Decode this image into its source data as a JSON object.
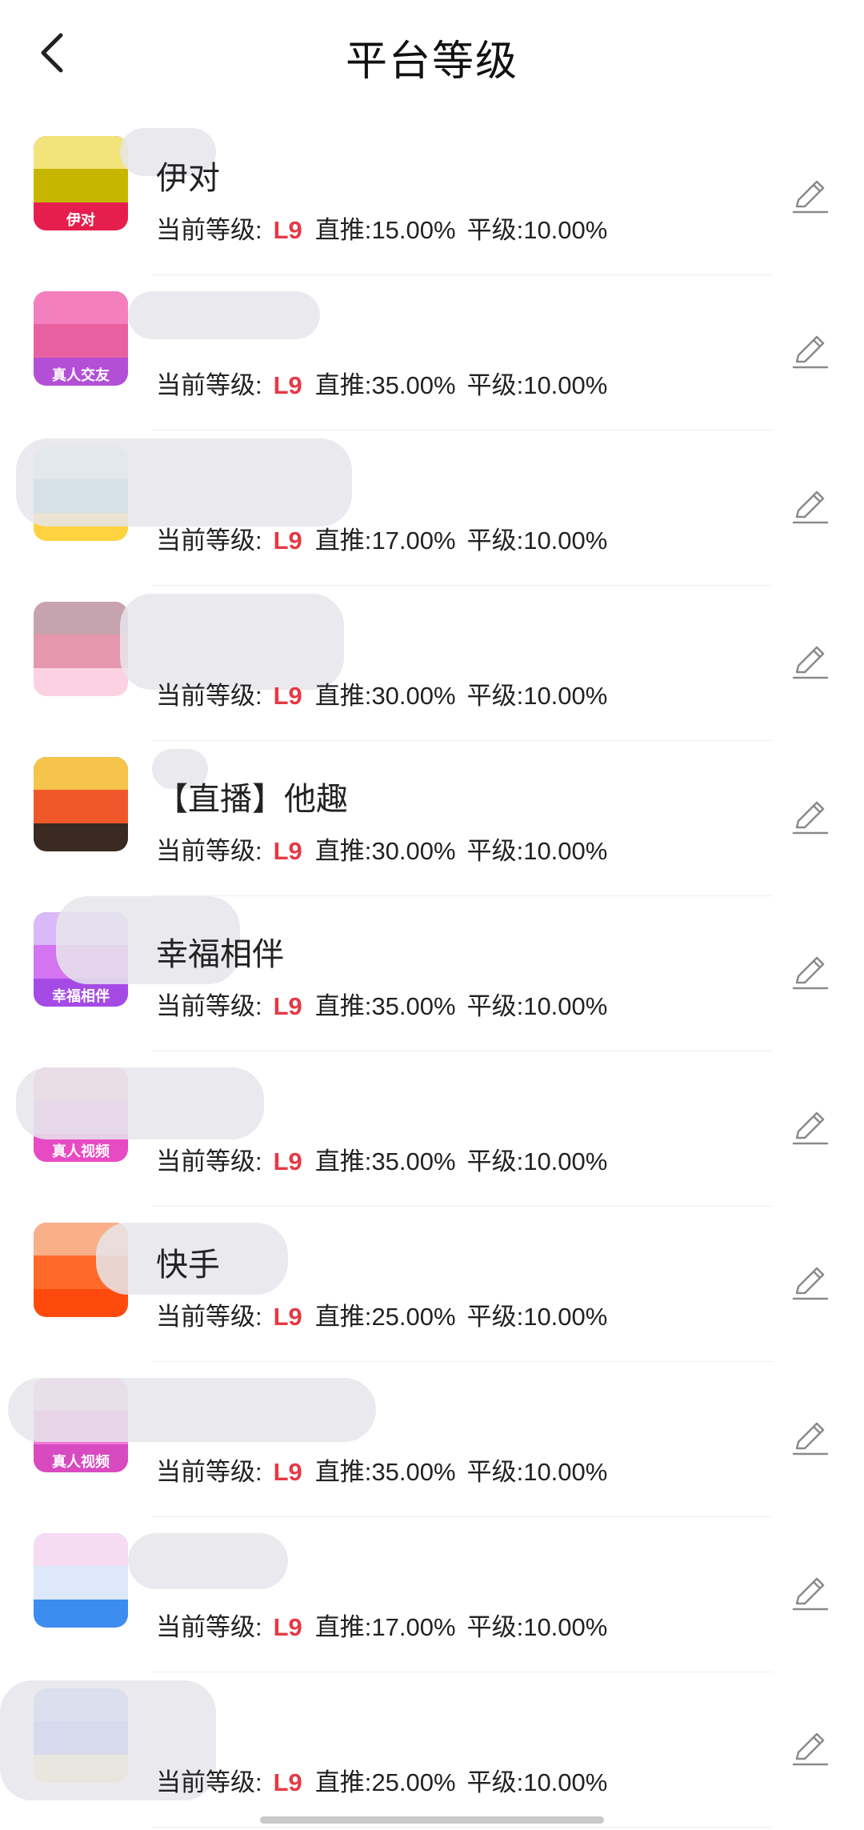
{
  "header": {
    "title": "平台等级"
  },
  "labels": {
    "current_level": "当前等级:",
    "direct": "直推:",
    "peer": "平级:"
  },
  "platforms": [
    {
      "name": "伊对",
      "icon_text": "伊对",
      "level": "L9",
      "direct": "15.00%",
      "peer": "10.00%",
      "colors": [
        "#f2e47a",
        "#c6b600",
        "#e61e4d"
      ]
    },
    {
      "name": "",
      "icon_text": "真人交友",
      "level": "L9",
      "direct": "35.00%",
      "peer": "10.00%",
      "colors": [
        "#f47fbf",
        "#e8609f",
        "#b34fd6"
      ]
    },
    {
      "name": "",
      "icon_text": "",
      "level": "L9",
      "direct": "17.00%",
      "peer": "10.00%",
      "colors": [
        "#cdeef7",
        "#74c3cf",
        "#ffd23f"
      ]
    },
    {
      "name": "",
      "icon_text": "",
      "level": "L9",
      "direct": "30.00%",
      "peer": "10.00%",
      "colors": [
        "#c7a3b0",
        "#e598ad",
        "#fcd2e2"
      ]
    },
    {
      "name": "【直播】他趣",
      "icon_text": "",
      "level": "L9",
      "direct": "30.00%",
      "peer": "10.00%",
      "colors": [
        "#f6c44a",
        "#f0582c",
        "#3a2a22"
      ]
    },
    {
      "name": "幸福相伴",
      "icon_text": "幸福相伴",
      "level": "L9",
      "direct": "35.00%",
      "peer": "10.00%",
      "colors": [
        "#d9b9f7",
        "#d574f0",
        "#a64ae6"
      ]
    },
    {
      "name": "",
      "icon_text": "真人视频",
      "level": "L9",
      "direct": "35.00%",
      "peer": "10.00%",
      "colors": [
        "#f9a6c9",
        "#f28ee0",
        "#e74bc4"
      ]
    },
    {
      "name": "快手",
      "icon_text": "",
      "level": "L9",
      "direct": "25.00%",
      "peer": "10.00%",
      "colors": [
        "#f9b089",
        "#ff6a2a",
        "#ff4a0e"
      ]
    },
    {
      "name": "",
      "icon_text": "真人视频",
      "level": "L9",
      "direct": "35.00%",
      "peer": "10.00%",
      "colors": [
        "#f6b3e6",
        "#f07bd8",
        "#d84bc0"
      ]
    },
    {
      "name": "",
      "icon_text": "",
      "level": "L9",
      "direct": "17.00%",
      "peer": "10.00%",
      "colors": [
        "#f6dcf2",
        "#dde8fa",
        "#3d8cf0"
      ]
    },
    {
      "name": "",
      "icon_text": "",
      "level": "L9",
      "direct": "25.00%",
      "peer": "10.00%",
      "colors": [
        "#9fb6fa",
        "#7d8cf7",
        "#efe39b"
      ]
    }
  ]
}
